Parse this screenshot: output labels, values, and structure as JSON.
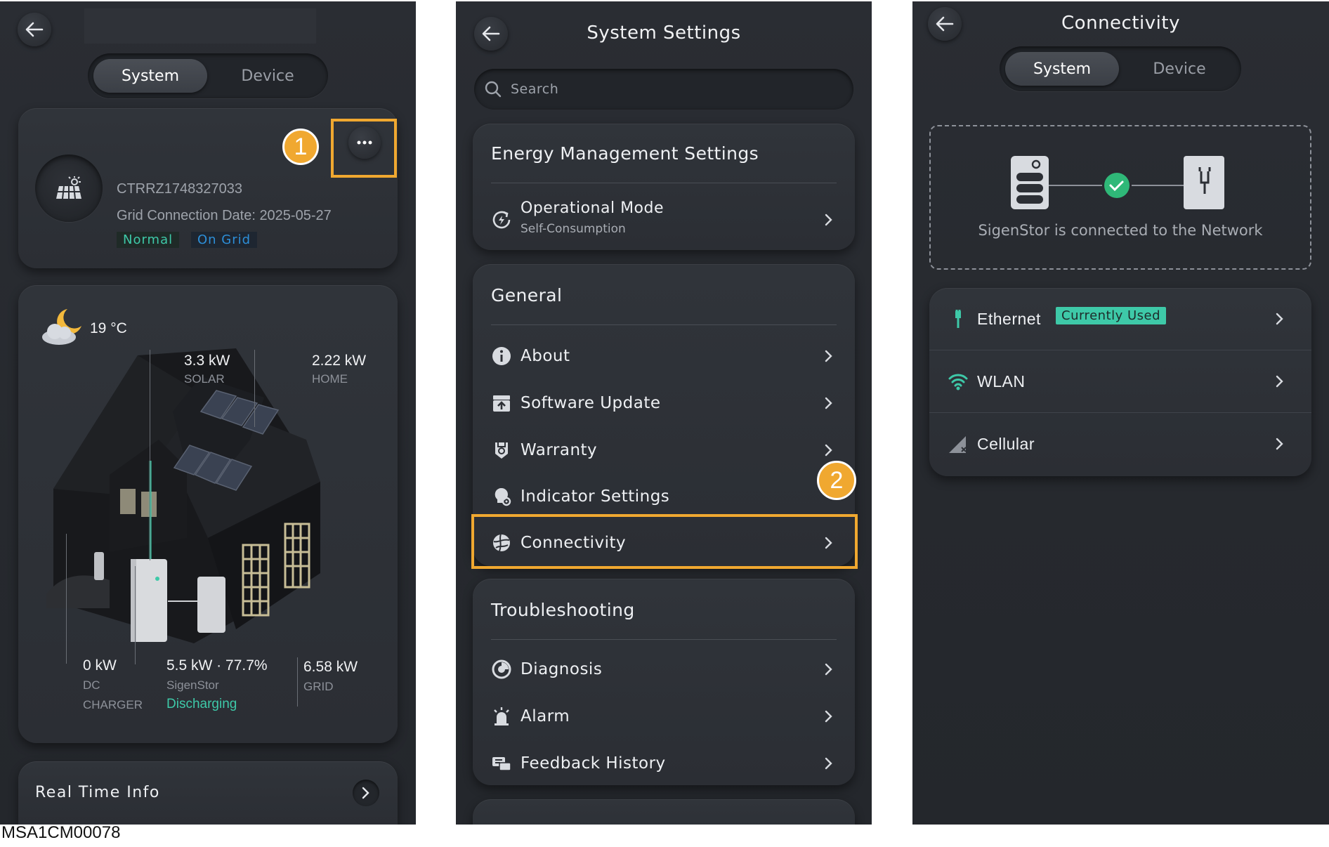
{
  "panel1": {
    "tabs": {
      "system": "System",
      "device": "Device"
    },
    "site": {
      "serial": "CTRRZ1748327033",
      "grid_connection": "Grid Connection Date: 2025-05-27",
      "status_normal": "Normal",
      "status_grid": "On Grid"
    },
    "weather": {
      "temp": "19 °C"
    },
    "flows": {
      "solar_value": "3.3 kW",
      "solar_label": "SOLAR",
      "home_value": "2.22 kW",
      "home_label": "HOME",
      "charger_value": "0 kW",
      "charger_label1": "DC",
      "charger_label2": "CHARGER",
      "sigenstor_value": "5.5 kW · 77.7%",
      "sigenstor_label": "SigenStor",
      "sigenstor_state": "Discharging",
      "grid_value": "6.58 kW",
      "grid_label": "GRID"
    },
    "realtime": "Real Time Info",
    "step": "1"
  },
  "panel2": {
    "title": "System Settings",
    "search_placeholder": "Search",
    "energy": {
      "title": "Energy Management Settings",
      "op_mode": "Operational Mode",
      "op_mode_value": "Self-Consumption"
    },
    "general": {
      "title": "General",
      "items": [
        "About",
        "Software Update",
        "Warranty",
        "Indicator Settings",
        "Connectivity"
      ]
    },
    "troubleshooting": {
      "title": "Troubleshooting",
      "items": [
        "Diagnosis",
        "Alarm",
        "Feedback History"
      ]
    },
    "step": "2"
  },
  "panel3": {
    "title": "Connectivity",
    "tabs": {
      "system": "System",
      "device": "Device"
    },
    "status": "SigenStor is connected to the Network",
    "items": {
      "ethernet": "Ethernet",
      "ethernet_badge": "Currently Used",
      "wlan": "WLAN",
      "cellular": "Cellular"
    }
  },
  "footer_code": "MSA1CM00078",
  "colors": {
    "accent_orange": "#f0a830",
    "teal": "#3ec9a8",
    "blue": "#2d8fd8",
    "bg": "#2a2d33"
  }
}
